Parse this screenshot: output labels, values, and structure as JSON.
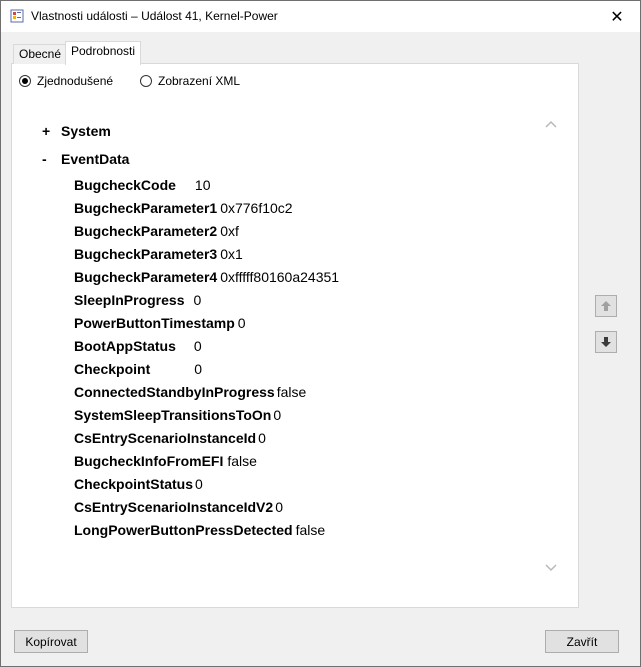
{
  "window": {
    "title": "Vlastnosti události – Událost 41, Kernel-Power",
    "close_glyph": "✕"
  },
  "tabs": [
    {
      "label": "Obecné",
      "active": false
    },
    {
      "label": "Podrobnosti",
      "active": true
    }
  ],
  "view_mode": {
    "options": [
      {
        "label": "Zjednodušené",
        "checked": true
      },
      {
        "label": "Zobrazení XML",
        "checked": false
      }
    ]
  },
  "tree": {
    "system": {
      "toggle": "+",
      "label": "System"
    },
    "eventdata": {
      "toggle": "-",
      "label": "EventData"
    },
    "rows": [
      {
        "key": "BugcheckCode",
        "value": "10"
      },
      {
        "key": "BugcheckParameter1",
        "value": "0x776f10c2"
      },
      {
        "key": "BugcheckParameter2",
        "value": "0xf"
      },
      {
        "key": "BugcheckParameter3",
        "value": "0x1"
      },
      {
        "key": "BugcheckParameter4",
        "value": "0xfffff80160a24351"
      },
      {
        "key": "SleepInProgress",
        "value": "0"
      },
      {
        "key": "PowerButtonTimestamp",
        "value": "0"
      },
      {
        "key": "BootAppStatus",
        "value": "0"
      },
      {
        "key": "Checkpoint",
        "value": "0"
      },
      {
        "key": "ConnectedStandbyInProgress",
        "value": "false"
      },
      {
        "key": "SystemSleepTransitionsToOn",
        "value": "0"
      },
      {
        "key": "CsEntryScenarioInstanceId",
        "value": "0"
      },
      {
        "key": "BugcheckInfoFromEFI",
        "value": "false"
      },
      {
        "key": "CheckpointStatus",
        "value": "0"
      },
      {
        "key": "CsEntryScenarioInstanceIdV2",
        "value": "0"
      },
      {
        "key": "LongPowerButtonPressDetected",
        "value": "false"
      }
    ]
  },
  "buttons": {
    "copy": "Kopírovat",
    "close": "Zavřít"
  },
  "icons": {
    "up": "arrow-up-icon",
    "down": "arrow-down-icon"
  },
  "colors": {
    "panel_bg": "#ffffff",
    "window_bg": "#f0f0f0",
    "button_bg": "#e1e1e1"
  }
}
